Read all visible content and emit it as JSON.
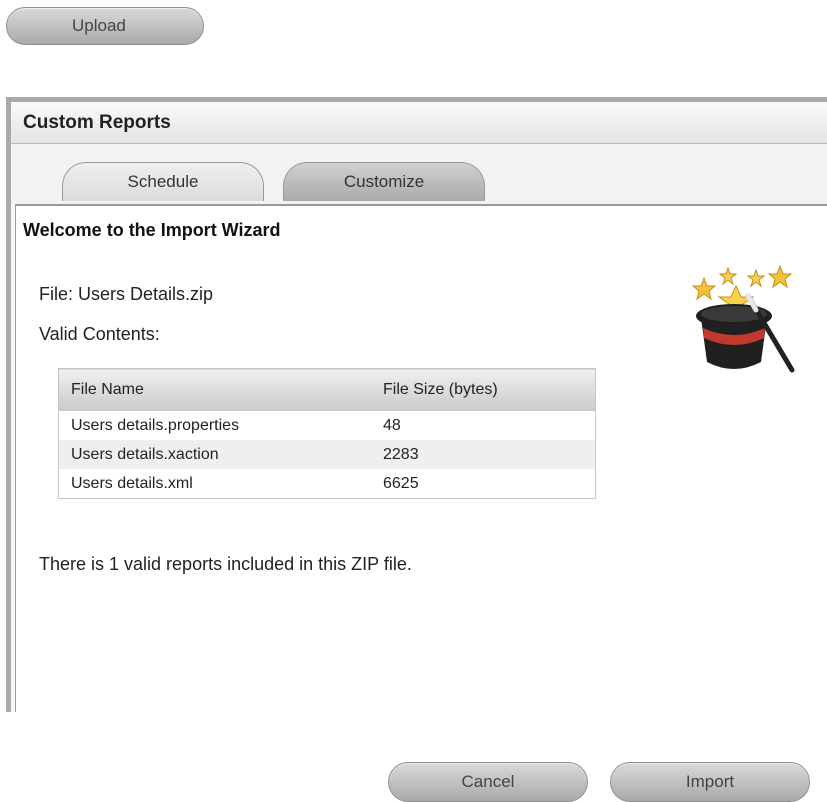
{
  "upload_button": {
    "label": "Upload"
  },
  "panel": {
    "title": "Custom Reports"
  },
  "tabs": [
    {
      "label": "Schedule"
    },
    {
      "label": "Customize"
    }
  ],
  "wizard": {
    "heading": "Welcome to the Import Wizard",
    "file_line": "File: Users Details.zip",
    "valid_contents_label": "Valid Contents:",
    "icon": "magic-hat-icon",
    "table": {
      "headers": [
        "File Name",
        "File Size (bytes)"
      ],
      "rows": [
        [
          "Users details.properties",
          "48"
        ],
        [
          "Users details.xaction",
          "2283"
        ],
        [
          "Users details.xml",
          "6625"
        ]
      ]
    },
    "summary": "There is 1 valid reports included in this ZIP file.",
    "cancel_label": "Cancel",
    "import_label": "Import"
  }
}
